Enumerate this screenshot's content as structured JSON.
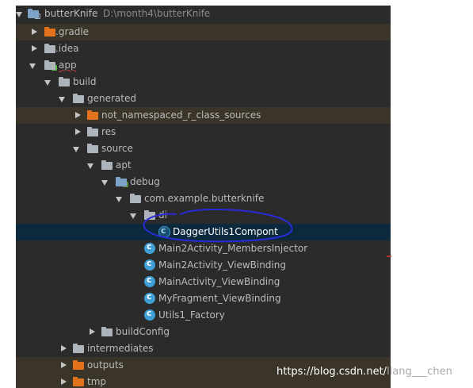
{
  "tree": {
    "root": {
      "label": "butterKnife",
      "path": "D:\\month4\\butterKnife"
    },
    "gradle": "gradle",
    "idea": "idea",
    "app": "app",
    "build": "build",
    "generated": "generated",
    "not_namespaced": "not_namespaced_r_class_sources",
    "res": "res",
    "source": "source",
    "apt": "apt",
    "debug": "debug",
    "package": "com.example.butterknife",
    "di": "di",
    "dagger_component": "DaggerUtils1Compont",
    "class1": "Main2Activity_MembersInjector",
    "class2": "Main2Activity_ViewBinding",
    "class3": "MainActivity_ViewBinding",
    "class4": "MyFragment_ViewBinding",
    "class5": "Utils1_Factory",
    "buildConfig": "buildConfig",
    "intermediates": "intermediates",
    "outputs": "outputs",
    "tmp": "tmp"
  },
  "watermark": {
    "site": "https://blog.csdn.net/",
    "user": "liang___chen"
  },
  "colors": {
    "panel_bg": "#2b2b2b",
    "selection_bg": "#0d293e",
    "excluded_bg": "#3a3528",
    "annotation": "#2a2ad8"
  }
}
